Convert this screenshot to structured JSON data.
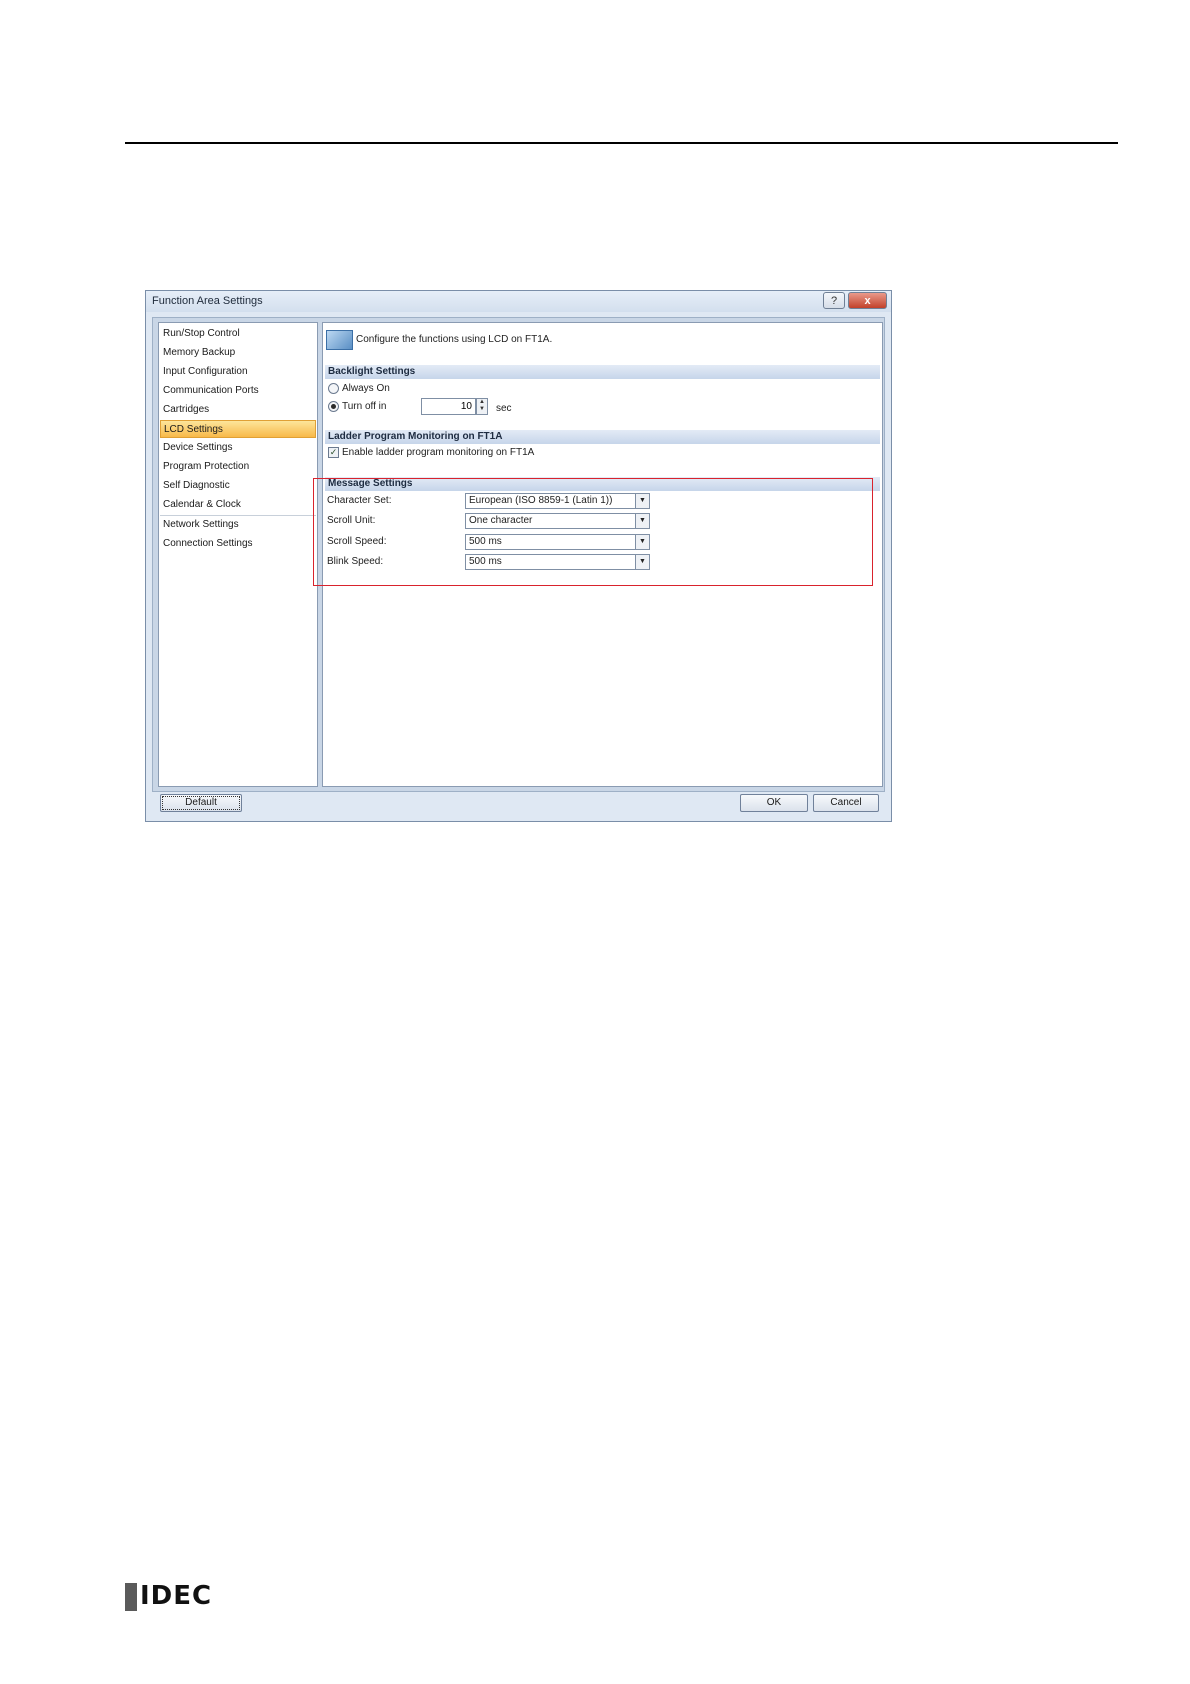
{
  "dialog": {
    "title": "Function Area Settings",
    "help_label": "?",
    "close_label": "x"
  },
  "sidebar": {
    "items": [
      {
        "label": "Run/Stop Control"
      },
      {
        "label": "Memory Backup"
      },
      {
        "label": "Input Configuration"
      },
      {
        "label": "Communication Ports"
      },
      {
        "label": "Cartridges"
      },
      {
        "label": "LCD Settings"
      },
      {
        "label": "Device Settings"
      },
      {
        "label": "Program Protection"
      },
      {
        "label": "Self Diagnostic"
      },
      {
        "label": "Calendar & Clock"
      },
      {
        "label": "Network Settings"
      },
      {
        "label": "Connection Settings"
      }
    ],
    "selected_index": 5
  },
  "main": {
    "intro": "Configure the functions using LCD on FT1A.",
    "backlight": {
      "header": "Backlight Settings",
      "always_on_label": "Always On",
      "turn_off_label": "Turn off in",
      "turn_off_value": "10",
      "unit": "sec",
      "selected": "Turn off in"
    },
    "ladder": {
      "header": "Ladder Program Monitoring on FT1A",
      "checkbox_label": "Enable ladder program monitoring on FT1A",
      "checked": true
    },
    "message": {
      "header": "Message Settings",
      "character_set_label": "Character Set:",
      "character_set_value": "European (ISO 8859-1 (Latin 1))",
      "scroll_unit_label": "Scroll Unit:",
      "scroll_unit_value": "One character",
      "scroll_speed_label": "Scroll Speed:",
      "scroll_speed_value": "500 ms",
      "blink_speed_label": "Blink Speed:",
      "blink_speed_value": "500 ms"
    }
  },
  "footer": {
    "default_label": "Default",
    "ok_label": "OK",
    "cancel_label": "Cancel"
  },
  "brand": {
    "logo_text": "IDEC"
  },
  "colors": {
    "highlight_box": "#d9232d",
    "selected_nav": "#f8b94a"
  }
}
